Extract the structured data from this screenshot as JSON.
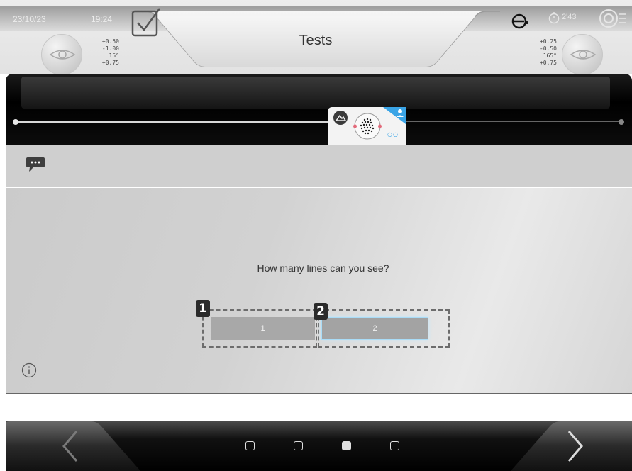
{
  "header": {
    "date": "23/10/23",
    "time": "19:24",
    "title": "Tests",
    "timer": "2'43",
    "left_rx": [
      "+0.50",
      "-1.00",
      "15°",
      "+0.75"
    ],
    "right_rx": [
      "+0.25",
      "-0.50",
      "165°",
      "+0.75"
    ]
  },
  "main": {
    "question": "How many lines can you see?",
    "answers": [
      {
        "badge": "1",
        "label": "1"
      },
      {
        "badge": "2",
        "label": "2"
      }
    ]
  },
  "footer": {
    "pages": 4,
    "active_page": 3
  },
  "colors": {
    "accent": "#3aa4e6",
    "selected_glow": "#a9dcf7"
  },
  "icons": [
    "check-icon",
    "eye-icon",
    "logo-icon",
    "timer-icon",
    "target-icon",
    "mountain-icon",
    "dots-target-icon",
    "person-icon",
    "chat-icon",
    "info-icon",
    "chevron-left-icon",
    "chevron-right-icon"
  ]
}
